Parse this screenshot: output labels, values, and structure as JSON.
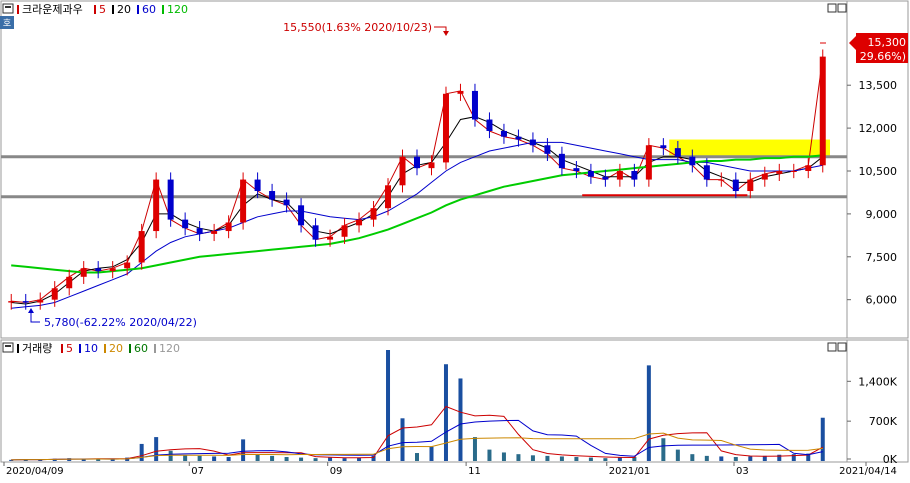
{
  "price_panel": {
    "legend": [
      {
        "label": "크라운제과우",
        "color": "#cc0000"
      },
      {
        "label": "5",
        "color": "#cc0000"
      },
      {
        "label": "20",
        "color": "#000000"
      },
      {
        "label": "60",
        "color": "#0000cc"
      },
      {
        "label": "120",
        "color": "#00bb00"
      }
    ],
    "max_annotation": "15,550(1.63% 2020/10/23)",
    "min_annotation": "5,780(-62.22% 2020/04/22)",
    "current_price_tag": "15,300",
    "current_change_tag": "( 29.66%)"
  },
  "volume_panel": {
    "legend": [
      {
        "label": "거래량",
        "color": "#000000"
      },
      {
        "label": "5",
        "color": "#cc0000"
      },
      {
        "label": "10",
        "color": "#0000cc"
      },
      {
        "label": "20",
        "color": "#cc8800"
      },
      {
        "label": "60",
        "color": "#007700"
      },
      {
        "label": "120",
        "color": "#999999"
      }
    ]
  },
  "colors": {
    "up": "#dd0000",
    "down": "#0000cc",
    "ma5": "#cc0000",
    "ma20": "#000000",
    "ma60": "#0000cc",
    "ma120": "#00cc00",
    "highlight": "#ffff00",
    "hline": "#888888",
    "support": "#dd0000"
  },
  "chart_data": [
    {
      "type": "line",
      "subtype": "candlestick",
      "title": "크라운제과우",
      "x_labels": [
        "2020/04/09",
        "07",
        "09",
        "11",
        "2021/01",
        "03",
        "2021/04/14"
      ],
      "y_ticks": [
        6000,
        7500,
        9000,
        10500,
        12000,
        13500
      ],
      "y_tick_labels": [
        "6,000",
        "7,500",
        "9,000",
        "10,500",
        "12,000",
        "13,500"
      ],
      "ylim": [
        4800,
        16200
      ],
      "x_range": [
        "2020/04/09",
        "2021/04/14"
      ],
      "series": [
        {
          "name": "5",
          "values": [
            5950,
            5900,
            6000,
            6400,
            6800,
            7100,
            7000,
            7100,
            7300,
            8400,
            10200,
            8800,
            8500,
            8300,
            8400,
            8700,
            10200,
            9800,
            9500,
            9300,
            8600,
            8100,
            8200,
            8600,
            8800,
            9200,
            10000,
            11000,
            10600,
            10800,
            13200,
            13300,
            12300,
            11900,
            11700,
            11600,
            11400,
            11100,
            10600,
            10500,
            10300,
            10200,
            10500,
            10200,
            11400,
            11300,
            11000,
            10700,
            10200,
            10200,
            9800,
            10200,
            10400,
            10500,
            10500,
            10700,
            14500
          ]
        },
        {
          "name": "20",
          "values": [
            5900,
            5850,
            5950,
            6200,
            6600,
            7000,
            7100,
            7150,
            7400,
            8000,
            9000,
            9000,
            8700,
            8500,
            8400,
            8600,
            9300,
            9700,
            9500,
            9400,
            8900,
            8400,
            8300,
            8500,
            8700,
            9000,
            9600,
            10400,
            10700,
            10800,
            11500,
            12300,
            12400,
            12200,
            11900,
            11700,
            11500,
            11300,
            10900,
            10700,
            10500,
            10300,
            10300,
            10300,
            10800,
            11000,
            11000,
            10900,
            10500,
            10300,
            10100,
            10100,
            10300,
            10400,
            10500,
            10600,
            11000
          ]
        },
        {
          "name": "60",
          "values": [
            5700,
            5750,
            5800,
            5900,
            6100,
            6300,
            6500,
            6700,
            6900,
            7300,
            7700,
            8000,
            8200,
            8300,
            8400,
            8500,
            8700,
            8900,
            9000,
            9100,
            9100,
            9000,
            8900,
            8850,
            8800,
            8900,
            9100,
            9400,
            9700,
            10100,
            10500,
            10800,
            11000,
            11200,
            11300,
            11400,
            11500,
            11500,
            11500,
            11400,
            11300,
            11200,
            11100,
            11000,
            10900,
            10900,
            10900,
            10800,
            10800,
            10700,
            10600,
            10500,
            10500,
            10500,
            10500,
            10600,
            10700
          ]
        },
        {
          "name": "120",
          "values": [
            7200,
            7150,
            7100,
            7050,
            7000,
            6950,
            6950,
            7000,
            7050,
            7100,
            7200,
            7300,
            7400,
            7500,
            7550,
            7600,
            7650,
            7700,
            7750,
            7800,
            7850,
            7900,
            7950,
            8050,
            8150,
            8300,
            8450,
            8650,
            8850,
            9050,
            9300,
            9500,
            9650,
            9800,
            9950,
            10050,
            10150,
            10250,
            10350,
            10400,
            10450,
            10500,
            10550,
            10600,
            10650,
            10700,
            10750,
            10800,
            10850,
            10850,
            10900,
            10900,
            10950,
            10950,
            11000,
            11000,
            11050
          ]
        }
      ],
      "annotations": [
        {
          "text": "15,550(1.63% 2020/10/23)",
          "x": "2020/10/23",
          "y": 15550
        },
        {
          "text": "5,780(-62.22% 2020/04/22)",
          "x": "2020/04/22",
          "y": 5780
        },
        {
          "text": "15,300 ( 29.66%)",
          "x": "2021/04/14",
          "y": 15300
        }
      ],
      "reference_lines": [
        11000,
        9600
      ],
      "highlight_zone": {
        "x": [
          "2021/02/01",
          "2021/04/14"
        ],
        "y": [
          11000,
          11600
        ]
      },
      "support_line": {
        "x": [
          "2020/12/24",
          "2021/03/08"
        ],
        "y": 9650
      }
    },
    {
      "type": "bar",
      "title": "거래량",
      "x_labels": [
        "2020/04/09",
        "07",
        "09",
        "11",
        "2021/01",
        "03",
        "2021/04/14"
      ],
      "y_ticks": [
        0,
        700000,
        1400000
      ],
      "y_tick_labels": [
        "0K",
        "700K",
        "1,400K"
      ],
      "ylim": [
        0,
        1950000
      ],
      "values": [
        20000,
        30000,
        25000,
        40000,
        50000,
        35000,
        40000,
        30000,
        60000,
        300000,
        420000,
        180000,
        100000,
        90000,
        80000,
        70000,
        380000,
        120000,
        90000,
        70000,
        60000,
        50000,
        60000,
        50000,
        60000,
        90000,
        1950000,
        750000,
        140000,
        250000,
        1700000,
        1450000,
        420000,
        200000,
        150000,
        120000,
        100000,
        90000,
        80000,
        70000,
        60000,
        50000,
        60000,
        70000,
        1680000,
        400000,
        200000,
        120000,
        90000,
        80000,
        70000,
        80000,
        90000,
        110000,
        120000,
        130000,
        760000
      ]
    }
  ]
}
